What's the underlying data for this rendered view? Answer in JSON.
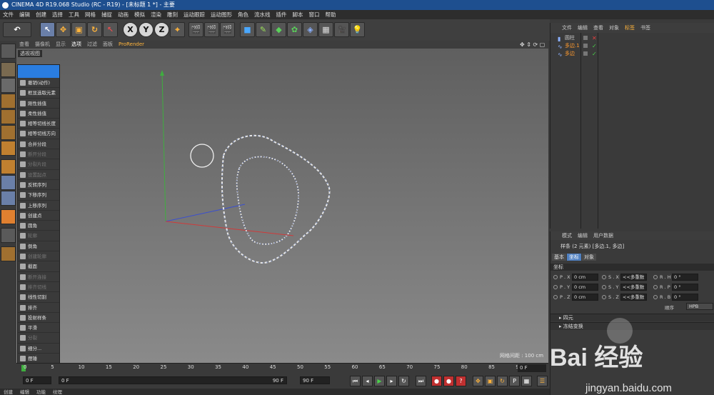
{
  "app": {
    "title": "CINEMA 4D R19.068 Studio (RC - R19) - [未标题 1 *] - 主要"
  },
  "menubar": [
    "文件",
    "编辑",
    "创建",
    "选择",
    "工具",
    "网格",
    "捕捉",
    "动画",
    "模拟",
    "渲染",
    "雕刻",
    "运动跟踪",
    "运动图形",
    "角色",
    "流水线",
    "插件",
    "脚本",
    "窗口",
    "帮助"
  ],
  "toolbar": {
    "x": "X",
    "y": "Y",
    "z": "Z"
  },
  "viewport": {
    "menu": [
      "查看",
      "摄像机",
      "显示",
      "选项",
      "过滤",
      "面板",
      "ProRender"
    ],
    "name": "透视视图",
    "status": "网格间距 : 100 cm",
    "accent_color": "#ffb43c"
  },
  "command_menu": {
    "items": [
      {
        "label": "撤销(动作)",
        "dim": false
      },
      {
        "label": "框显选取元素",
        "dim": false
      },
      {
        "label": "刚性插值",
        "dim": false
      },
      {
        "label": "柔性插值",
        "dim": false
      },
      {
        "label": "相等切线长度",
        "dim": false
      },
      {
        "label": "相等切线方向",
        "dim": false
      },
      {
        "label": "合并分段",
        "dim": false
      },
      {
        "label": "断开分段",
        "dim": true
      },
      {
        "label": "分裂片段",
        "dim": true
      },
      {
        "label": "设置起点",
        "dim": true
      },
      {
        "label": "反转序列",
        "dim": false
      },
      {
        "label": "下移序列",
        "dim": false
      },
      {
        "label": "上移序列",
        "dim": false
      },
      {
        "label": "创建点",
        "dim": false
      },
      {
        "label": "圆角",
        "dim": false
      },
      {
        "label": "轮廓",
        "dim": true
      },
      {
        "label": "倒角",
        "dim": false
      },
      {
        "label": "创建轮廓",
        "dim": true
      },
      {
        "label": "截面",
        "dim": false
      },
      {
        "label": "断开连接",
        "dim": true
      },
      {
        "label": "排齐切线",
        "dim": true
      },
      {
        "label": "线性切割",
        "dim": false
      },
      {
        "label": "排齐",
        "dim": false
      },
      {
        "label": "投射样条",
        "dim": false
      },
      {
        "label": "平滑",
        "dim": false
      },
      {
        "label": "分裂",
        "dim": true
      },
      {
        "label": "细分...",
        "dim": false
      },
      {
        "label": "摆锤",
        "dim": false
      }
    ]
  },
  "timeline": {
    "ticks": [
      "0",
      "5",
      "10",
      "15",
      "20",
      "25",
      "30",
      "35",
      "40",
      "45",
      "50",
      "55",
      "60",
      "65",
      "70",
      "75",
      "80",
      "85",
      "90"
    ],
    "frame_display": "0 F"
  },
  "transport": {
    "start_field": "0 F",
    "min_field": "0 F",
    "max_field": "90 F",
    "end_field": "90 F"
  },
  "bottom_bar": [
    "创建",
    "编辑",
    "功能",
    "纹理"
  ],
  "object_manager": {
    "menu": [
      "文件",
      "编辑",
      "查看",
      "对象",
      "标签",
      "书签"
    ],
    "objects": [
      {
        "name": "圆柱",
        "selected": false
      },
      {
        "name": "多边.1",
        "selected": true
      },
      {
        "name": "多边",
        "selected": true
      }
    ]
  },
  "attribute_manager": {
    "menu": [
      "模式",
      "编辑",
      "用户数据"
    ],
    "info": "样条 (2 元素) [多边.1, 多边]",
    "tabs": [
      {
        "label": "基本",
        "on": false
      },
      {
        "label": "坐标",
        "on": true
      },
      {
        "label": "对象",
        "on": false
      }
    ],
    "section": "坐标",
    "rows": [
      {
        "p_label": "P . X",
        "p_val": "0 cm",
        "s_label": "S . X",
        "s_val": "<<多重数",
        "r_label": "R . H",
        "r_val": "0 °"
      },
      {
        "p_label": "P . Y",
        "p_val": "0 cm",
        "s_label": "S . Y",
        "s_val": "<<多重数",
        "r_label": "R . P",
        "r_val": "0 °"
      },
      {
        "p_label": "P . Z",
        "p_val": "0 cm",
        "s_label": "S . Z",
        "s_val": "<<多重数",
        "r_label": "R . B",
        "r_val": "0 °"
      }
    ],
    "order_label": "顺序",
    "order_value": "HPB",
    "folds": [
      "四元",
      "冻结变换"
    ]
  },
  "watermark": {
    "text": "Bai 经验",
    "url": "jingyan.baidu.com"
  }
}
